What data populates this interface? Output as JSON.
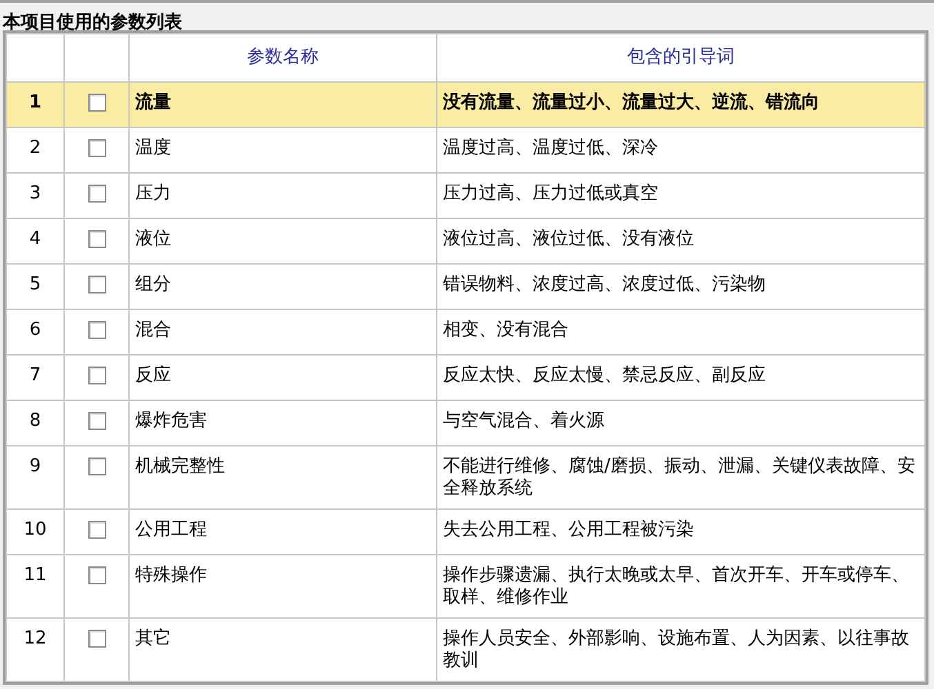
{
  "panel": {
    "title": "本项目使用的参数列表"
  },
  "table": {
    "columns": [
      "参数名称",
      "包含的引导词"
    ],
    "rows": [
      {
        "number": "1",
        "checked": false,
        "selected": true,
        "name": "流量",
        "guide_words": "没有流量、流量过小、流量过大、逆流、错流向"
      },
      {
        "number": "2",
        "checked": false,
        "selected": false,
        "name": "温度",
        "guide_words": "温度过高、温度过低、深冷"
      },
      {
        "number": "3",
        "checked": false,
        "selected": false,
        "name": "压力",
        "guide_words": "压力过高、压力过低或真空"
      },
      {
        "number": "4",
        "checked": false,
        "selected": false,
        "name": "液位",
        "guide_words": "液位过高、液位过低、没有液位"
      },
      {
        "number": "5",
        "checked": false,
        "selected": false,
        "name": "组分",
        "guide_words": "错误物料、浓度过高、浓度过低、污染物"
      },
      {
        "number": "6",
        "checked": false,
        "selected": false,
        "name": "混合",
        "guide_words": "相变、没有混合"
      },
      {
        "number": "7",
        "checked": false,
        "selected": false,
        "name": "反应",
        "guide_words": "反应太快、反应太慢、禁忌反应、副反应"
      },
      {
        "number": "8",
        "checked": false,
        "selected": false,
        "name": "爆炸危害",
        "guide_words": "与空气混合、着火源"
      },
      {
        "number": "9",
        "checked": false,
        "selected": false,
        "name": "机械完整性",
        "guide_words": "不能进行维修、腐蚀/磨损、振动、泄漏、关键仪表故障、安全释放系统"
      },
      {
        "number": "10",
        "checked": false,
        "selected": false,
        "name": "公用工程",
        "guide_words": "失去公用工程、公用工程被污染"
      },
      {
        "number": "11",
        "checked": false,
        "selected": false,
        "name": "特殊操作",
        "guide_words": "操作步骤遗漏、执行太晚或太早、首次开车、开车或停车、取样、维修作业"
      },
      {
        "number": "12",
        "checked": false,
        "selected": false,
        "name": "其它",
        "guide_words": "操作人员安全、外部影响、设施布置、人为因素、以往事故教训"
      }
    ]
  }
}
